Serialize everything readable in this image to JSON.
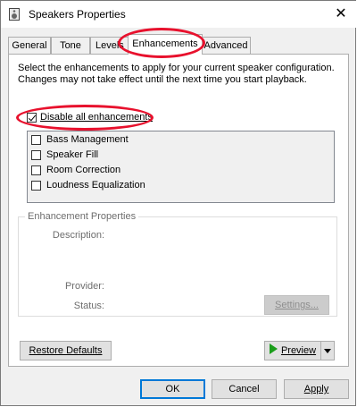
{
  "window": {
    "title": "Speakers Properties",
    "close_glyph": "✕"
  },
  "tabs": [
    {
      "label": "General"
    },
    {
      "label": "Tone"
    },
    {
      "label": "Levels"
    },
    {
      "label": "Enhancements"
    },
    {
      "label": "Advanced"
    }
  ],
  "enhancements": {
    "description": "Select the enhancements to apply for your current speaker configuration. Changes may not take effect until the next time you start playback.",
    "disable_all_label": "Disable all enhancements",
    "disable_all_checked": true,
    "items": [
      {
        "label": "Bass Management",
        "checked": false
      },
      {
        "label": "Speaker Fill",
        "checked": false
      },
      {
        "label": "Room Correction",
        "checked": false
      },
      {
        "label": "Loudness Equalization",
        "checked": false
      }
    ]
  },
  "properties": {
    "title": "Enhancement Properties",
    "description_label": "Description:",
    "provider_label": "Provider:",
    "status_label": "Status:",
    "settings_button": "Settings..."
  },
  "buttons": {
    "restore_defaults": "Restore Defaults",
    "preview": "Preview",
    "ok": "OK",
    "cancel": "Cancel",
    "apply": "Apply"
  },
  "colors": {
    "highlight": "#e8112d",
    "accent": "#0078d7",
    "play": "#1a9d1a"
  }
}
